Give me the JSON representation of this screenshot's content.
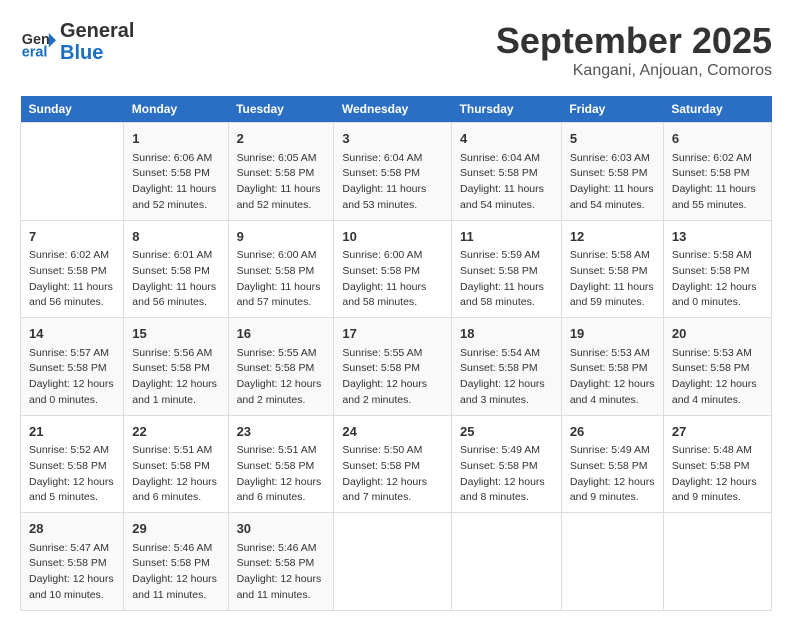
{
  "header": {
    "logo_line1": "General",
    "logo_line2": "Blue",
    "month": "September 2025",
    "location": "Kangani, Anjouan, Comoros"
  },
  "weekdays": [
    "Sunday",
    "Monday",
    "Tuesday",
    "Wednesday",
    "Thursday",
    "Friday",
    "Saturday"
  ],
  "weeks": [
    [
      {
        "day": "",
        "sunrise": "",
        "sunset": "",
        "daylight": ""
      },
      {
        "day": "1",
        "sunrise": "Sunrise: 6:06 AM",
        "sunset": "Sunset: 5:58 PM",
        "daylight": "Daylight: 11 hours and 52 minutes."
      },
      {
        "day": "2",
        "sunrise": "Sunrise: 6:05 AM",
        "sunset": "Sunset: 5:58 PM",
        "daylight": "Daylight: 11 hours and 52 minutes."
      },
      {
        "day": "3",
        "sunrise": "Sunrise: 6:04 AM",
        "sunset": "Sunset: 5:58 PM",
        "daylight": "Daylight: 11 hours and 53 minutes."
      },
      {
        "day": "4",
        "sunrise": "Sunrise: 6:04 AM",
        "sunset": "Sunset: 5:58 PM",
        "daylight": "Daylight: 11 hours and 54 minutes."
      },
      {
        "day": "5",
        "sunrise": "Sunrise: 6:03 AM",
        "sunset": "Sunset: 5:58 PM",
        "daylight": "Daylight: 11 hours and 54 minutes."
      },
      {
        "day": "6",
        "sunrise": "Sunrise: 6:02 AM",
        "sunset": "Sunset: 5:58 PM",
        "daylight": "Daylight: 11 hours and 55 minutes."
      }
    ],
    [
      {
        "day": "7",
        "sunrise": "Sunrise: 6:02 AM",
        "sunset": "Sunset: 5:58 PM",
        "daylight": "Daylight: 11 hours and 56 minutes."
      },
      {
        "day": "8",
        "sunrise": "Sunrise: 6:01 AM",
        "sunset": "Sunset: 5:58 PM",
        "daylight": "Daylight: 11 hours and 56 minutes."
      },
      {
        "day": "9",
        "sunrise": "Sunrise: 6:00 AM",
        "sunset": "Sunset: 5:58 PM",
        "daylight": "Daylight: 11 hours and 57 minutes."
      },
      {
        "day": "10",
        "sunrise": "Sunrise: 6:00 AM",
        "sunset": "Sunset: 5:58 PM",
        "daylight": "Daylight: 11 hours and 58 minutes."
      },
      {
        "day": "11",
        "sunrise": "Sunrise: 5:59 AM",
        "sunset": "Sunset: 5:58 PM",
        "daylight": "Daylight: 11 hours and 58 minutes."
      },
      {
        "day": "12",
        "sunrise": "Sunrise: 5:58 AM",
        "sunset": "Sunset: 5:58 PM",
        "daylight": "Daylight: 11 hours and 59 minutes."
      },
      {
        "day": "13",
        "sunrise": "Sunrise: 5:58 AM",
        "sunset": "Sunset: 5:58 PM",
        "daylight": "Daylight: 12 hours and 0 minutes."
      }
    ],
    [
      {
        "day": "14",
        "sunrise": "Sunrise: 5:57 AM",
        "sunset": "Sunset: 5:58 PM",
        "daylight": "Daylight: 12 hours and 0 minutes."
      },
      {
        "day": "15",
        "sunrise": "Sunrise: 5:56 AM",
        "sunset": "Sunset: 5:58 PM",
        "daylight": "Daylight: 12 hours and 1 minute."
      },
      {
        "day": "16",
        "sunrise": "Sunrise: 5:55 AM",
        "sunset": "Sunset: 5:58 PM",
        "daylight": "Daylight: 12 hours and 2 minutes."
      },
      {
        "day": "17",
        "sunrise": "Sunrise: 5:55 AM",
        "sunset": "Sunset: 5:58 PM",
        "daylight": "Daylight: 12 hours and 2 minutes."
      },
      {
        "day": "18",
        "sunrise": "Sunrise: 5:54 AM",
        "sunset": "Sunset: 5:58 PM",
        "daylight": "Daylight: 12 hours and 3 minutes."
      },
      {
        "day": "19",
        "sunrise": "Sunrise: 5:53 AM",
        "sunset": "Sunset: 5:58 PM",
        "daylight": "Daylight: 12 hours and 4 minutes."
      },
      {
        "day": "20",
        "sunrise": "Sunrise: 5:53 AM",
        "sunset": "Sunset: 5:58 PM",
        "daylight": "Daylight: 12 hours and 4 minutes."
      }
    ],
    [
      {
        "day": "21",
        "sunrise": "Sunrise: 5:52 AM",
        "sunset": "Sunset: 5:58 PM",
        "daylight": "Daylight: 12 hours and 5 minutes."
      },
      {
        "day": "22",
        "sunrise": "Sunrise: 5:51 AM",
        "sunset": "Sunset: 5:58 PM",
        "daylight": "Daylight: 12 hours and 6 minutes."
      },
      {
        "day": "23",
        "sunrise": "Sunrise: 5:51 AM",
        "sunset": "Sunset: 5:58 PM",
        "daylight": "Daylight: 12 hours and 6 minutes."
      },
      {
        "day": "24",
        "sunrise": "Sunrise: 5:50 AM",
        "sunset": "Sunset: 5:58 PM",
        "daylight": "Daylight: 12 hours and 7 minutes."
      },
      {
        "day": "25",
        "sunrise": "Sunrise: 5:49 AM",
        "sunset": "Sunset: 5:58 PM",
        "daylight": "Daylight: 12 hours and 8 minutes."
      },
      {
        "day": "26",
        "sunrise": "Sunrise: 5:49 AM",
        "sunset": "Sunset: 5:58 PM",
        "daylight": "Daylight: 12 hours and 9 minutes."
      },
      {
        "day": "27",
        "sunrise": "Sunrise: 5:48 AM",
        "sunset": "Sunset: 5:58 PM",
        "daylight": "Daylight: 12 hours and 9 minutes."
      }
    ],
    [
      {
        "day": "28",
        "sunrise": "Sunrise: 5:47 AM",
        "sunset": "Sunset: 5:58 PM",
        "daylight": "Daylight: 12 hours and 10 minutes."
      },
      {
        "day": "29",
        "sunrise": "Sunrise: 5:46 AM",
        "sunset": "Sunset: 5:58 PM",
        "daylight": "Daylight: 12 hours and 11 minutes."
      },
      {
        "day": "30",
        "sunrise": "Sunrise: 5:46 AM",
        "sunset": "Sunset: 5:58 PM",
        "daylight": "Daylight: 12 hours and 11 minutes."
      },
      {
        "day": "",
        "sunrise": "",
        "sunset": "",
        "daylight": ""
      },
      {
        "day": "",
        "sunrise": "",
        "sunset": "",
        "daylight": ""
      },
      {
        "day": "",
        "sunrise": "",
        "sunset": "",
        "daylight": ""
      },
      {
        "day": "",
        "sunrise": "",
        "sunset": "",
        "daylight": ""
      }
    ]
  ]
}
